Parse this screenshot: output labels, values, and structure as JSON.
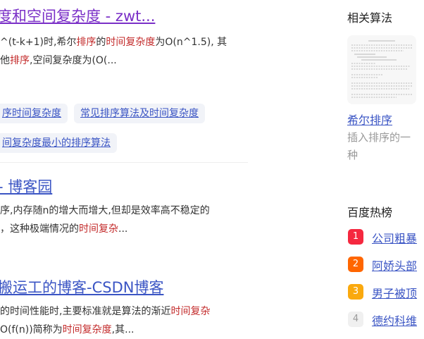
{
  "results": [
    {
      "title_pre": "度和空间复杂度 - zwt...",
      "snippet1_a": "^(t-k+1)时,希尔",
      "snippet1_b": "排序",
      "snippet1_c": "的",
      "snippet1_d": "时间复杂度",
      "snippet1_e": "为O(n^1.5), 其",
      "snippet2_a": "他",
      "snippet2_b": "排序",
      "snippet2_c": ",空间复杂度为(O(..."
    },
    {
      "title": "- 博客园",
      "snippet1": "序,内存随n的增大而增大,但却是效率高不稳定的",
      "snippet2_a": "，这种极端情况的",
      "snippet2_b": "时间复杂",
      "snippet2_c": "..."
    },
    {
      "title": "搬运工的博客-CSDN博客",
      "snippet1_a": "的时间性能时,主要标准就是算法的渐近",
      "snippet1_b": "时间复杂",
      "snippet2_a": "O(f(n))简称为",
      "snippet2_b": "时间复杂度",
      "snippet2_c": ",其..."
    }
  ],
  "chips": [
    "序时间复杂度",
    "常见排序算法及时间复杂度",
    "间复杂度最小的排序算法"
  ],
  "sidebar": {
    "related_heading": "相关算法",
    "related_item": {
      "title": "希尔排序",
      "desc_line1": "插入排序的一",
      "desc_line2": "种"
    },
    "hot_heading": "百度热榜",
    "hot_items": [
      {
        "rank": "1",
        "text": "公司粗暴",
        "color": "#f5283f"
      },
      {
        "rank": "2",
        "text": "阿娇头部",
        "color": "#ff6600"
      },
      {
        "rank": "3",
        "text": "男子被顶",
        "color": "#faa90e"
      },
      {
        "rank": "4",
        "text": "德约科维",
        "color": "#f0f0f0"
      }
    ]
  }
}
